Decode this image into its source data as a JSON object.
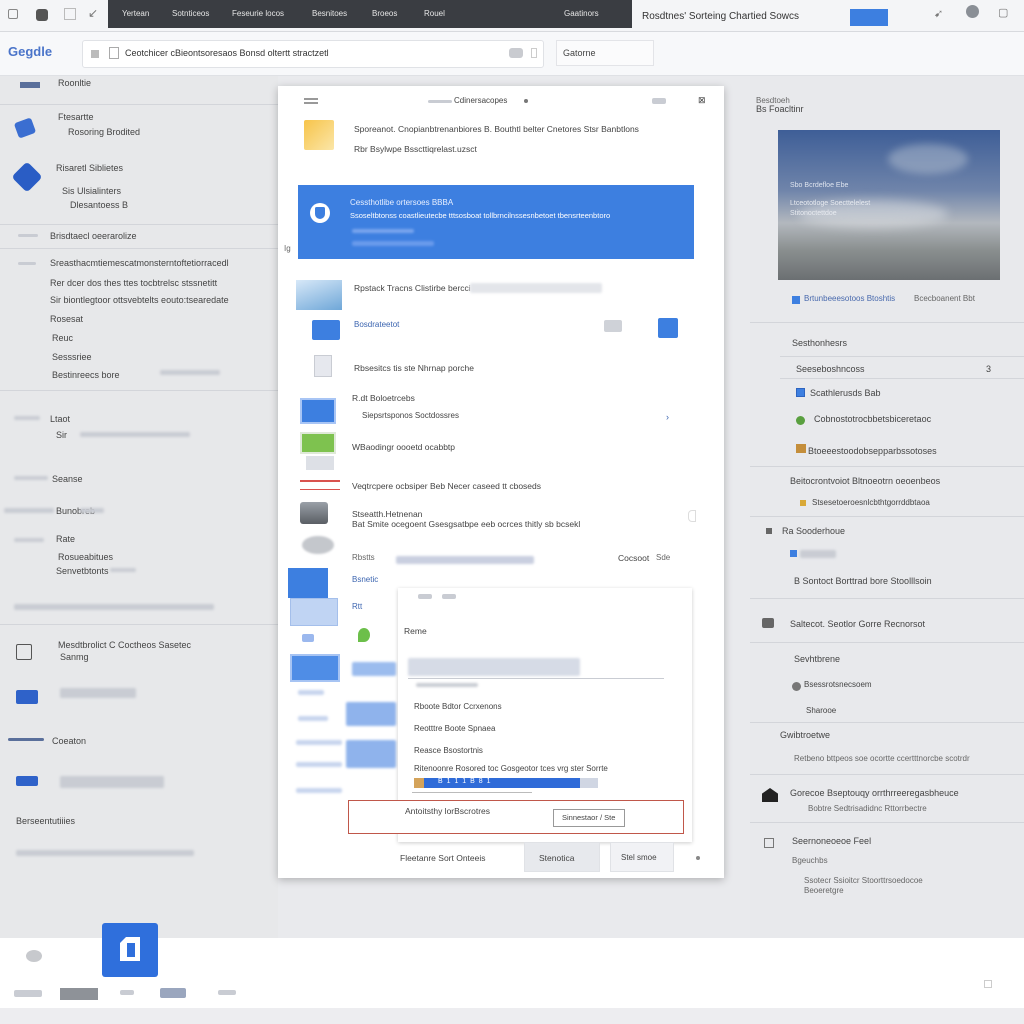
{
  "browser": {
    "tabs": [
      "Yertean",
      "Sotnticeos",
      "Feseurie locos",
      "Besnitoes",
      "Broeos",
      "Rouel",
      "Gaatinors"
    ],
    "window_title": "Rosdtnes' Sorteing Chartied Sowcs",
    "omnibox_text": "Ceotchicer cBieontsoresaos Bonsd oltertt stractzetl",
    "side_box": "Gatorne",
    "logo": "Gegdle"
  },
  "left_panel": {
    "items": [
      "Roonltie",
      "Ftesartte",
      "Rosoring Brodited",
      "Risaretl Siblietes",
      "Sis Ulsialinters",
      "Dlesantoess B",
      "Brisdtaecl oeerarolize",
      "Sreasthacmtiemescatmonsterntoftetiorracedl",
      "Rer dcer dos thes ttes tocbtrelsc stssnetitt",
      "Sir biontlegtoor ottsvebtelts eouto:tsearedate",
      "Rosesat",
      "Reuc",
      "Sesssriee",
      "Bestinreecs bore",
      "Ltaot",
      "Sir",
      "Seanse",
      "Bunobreb",
      "Rate",
      "Rosueabitues",
      "Senvetbtonts",
      "Mesdtbrolict C Coctheos Sasetec",
      "Sanmg",
      "Coeaton",
      "Berseentutiiies"
    ]
  },
  "dialog": {
    "header": "Cdinersacopes",
    "intro_line1": "Sporeanot. Cnopianbtrenanbiores B. Bouthtl belter Cnetores Stsr Banbtlons",
    "intro_line2": "Rbr Bsylwpe Bsscttiqrelast.uzsct",
    "banner_title": "Cessthotlibe ortersoes BBBA",
    "banner_text": "Ssoseltbtonss coastlieutecbe tttsosboat tollbrncilnssesnbetoet tbensrteenbtoro",
    "list": [
      "Rpstack Tracns Clistirbe bercci",
      "Bosdrateetot",
      "Rbsesitcs tis ste Nhrnap porche",
      "R.dt Boloetrcebs",
      "Siepsrtsponos Soctdossres",
      "WBaodingr oooetd ocabbtp",
      "Veqtrcpere ocbsiper Beb Necer caseed tt cboseds",
      "Stseatth.Hetnenan",
      "Bat Smite ocegoent Gsesgsatbpe eeb ocrces thitly sb bcsekl",
      "Rbstts",
      "Cocsoot",
      "Sde",
      "Bsnetic",
      "Rtt"
    ],
    "sub": {
      "header": "Reme",
      "items": [
        "Rboote Bdtor Ccrxenons",
        "Reotttre Boote Spnaea",
        "Reasce Bsostortnis",
        "Ritenoonre Rosored toc Gosgeotor tces vrg ster Sorrte"
      ],
      "progress_label": "B  1  1  1  B  8  1",
      "progress": 0.9,
      "red_text": "Antoitsthy lorBscrotres",
      "red_button": "Sinnestaor / Ste"
    },
    "footer_link": "Fleetanre Sort Onteeis",
    "footer_primary": "Stenotica",
    "footer_secondary": "Stel smoe"
  },
  "right_panel": {
    "header_small": "Besdtoeh",
    "header": "Bs Foacltinr",
    "image_text": [
      "Sbo Bcrdefloe Ebe",
      "Ltceototloge Soecttelelest",
      "Stitonoctettdoe"
    ],
    "image_caption": "Brtunbeeesotoos Btoshtis",
    "image_caption2": "Bcecboanent Bbt",
    "rows": [
      "Sesthonhesrs",
      "Seeseboshncoss",
      "Scathlerusds Bab",
      "Cobnostotrocbbetsbiceretaoc",
      "Btoeeestoodobsepparbssotoses",
      "Beitocrontvoiot Bltnoeotrn oeoenbeos",
      "Stsesetoeroesnlcbthtgorrddbtaoa",
      "Ra Sooderhoue",
      "B Sontoct Borttrad bore Stoolllsoin",
      "Saltecot. Seotlor Gorre Recnorsot",
      "Sevhtbrene",
      "Bsessrotsnecsoem",
      "Sharooe",
      "Gwibtroetwe",
      "Retbeno bttpeos soe ocortte ccertttnorcbe scotrdr",
      "Gorecoe Bseptouqy orrthrreeregasbheuce",
      "Bobtre Sedtrisadidnc Rttorrbectre",
      "Seernoneoeoe Feel",
      "Bgeuchbs",
      "Ssotecr Ssioitcr Stoorttrsoedocoe",
      "Beoeretgre"
    ],
    "count": "3"
  },
  "colors": {
    "accent": "#3d7fe0",
    "dark_tabs": "#3a3d42",
    "alert": "#c0574a"
  }
}
